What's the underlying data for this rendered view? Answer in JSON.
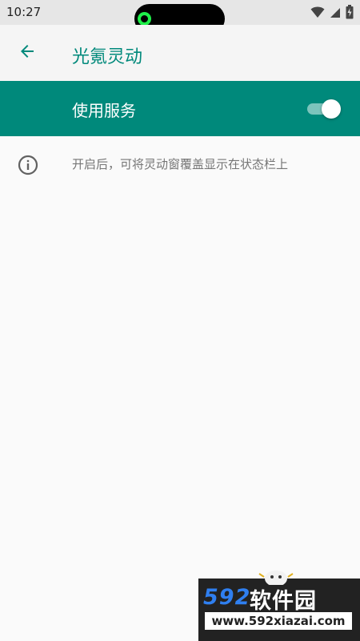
{
  "status_bar": {
    "time": "10:27",
    "icons": [
      "wifi-icon",
      "cell-signal-icon",
      "battery-charging-icon"
    ]
  },
  "app_bar": {
    "back_icon": "arrow-left-icon",
    "title": "光氪灵动"
  },
  "service": {
    "label": "使用服务",
    "enabled": true
  },
  "info": {
    "icon": "info-icon",
    "text": "开启后，可将灵动窗覆盖显示在状态栏上"
  },
  "colors": {
    "accent": "#00897b",
    "title": "#00897b",
    "info_text": "#757575",
    "background": "#fafafa"
  },
  "watermark": {
    "logo_number": "592",
    "logo_text": "软件园",
    "url": "www.592xiazai.com"
  }
}
